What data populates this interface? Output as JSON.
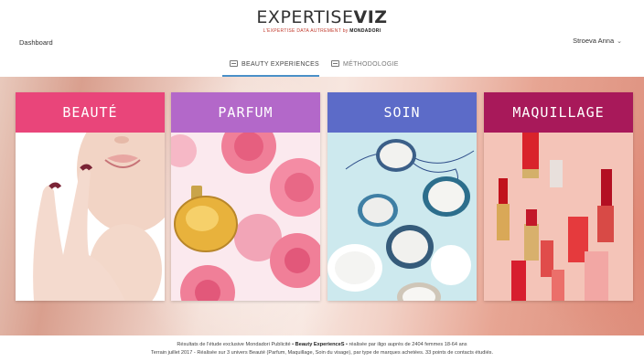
{
  "header": {
    "logo_prefix": "EXPERTISE",
    "logo_suffix": "VIZ",
    "logo_tagline": "L'EXPERTISE DATA AUTREMENT",
    "logo_by": "by",
    "logo_brand": "MONDADORI",
    "dashboard_label": "Dashboard",
    "user_name": "Stroeva Anna"
  },
  "tabs": [
    {
      "label": "BEAUTY EXPERIENCES",
      "active": true
    },
    {
      "label": "MÉTHODOLOGIE",
      "active": false
    }
  ],
  "cards": [
    {
      "label": "BEAUTÉ",
      "color": "#e9457a"
    },
    {
      "label": "PARFUM",
      "color": "#b368c9"
    },
    {
      "label": "SOIN",
      "color": "#5c6bc8"
    },
    {
      "label": "MAQUILLAGE",
      "color": "#a8195a"
    }
  ],
  "footer": {
    "line1_pre": "Résultats de l'étude exclusive Mondadori Publicité",
    "line1_bold": "Beauty ExperienceS",
    "line1_post": "réalisée par iligo auprès de 2404 femmes 18-64 ans",
    "line2": "Terrain juillet 2017 - Réalisée sur 3 univers Beauté (Parfum, Maquillage, Soin du visage), par type de marques achetées. 33 points de contacts étudiés."
  },
  "colors": {
    "accent": "#4a90c8",
    "logo_tagline": "#c0392b"
  },
  "icons": {
    "user_menu": "chevron-down-icon",
    "tab": "book-icon"
  }
}
